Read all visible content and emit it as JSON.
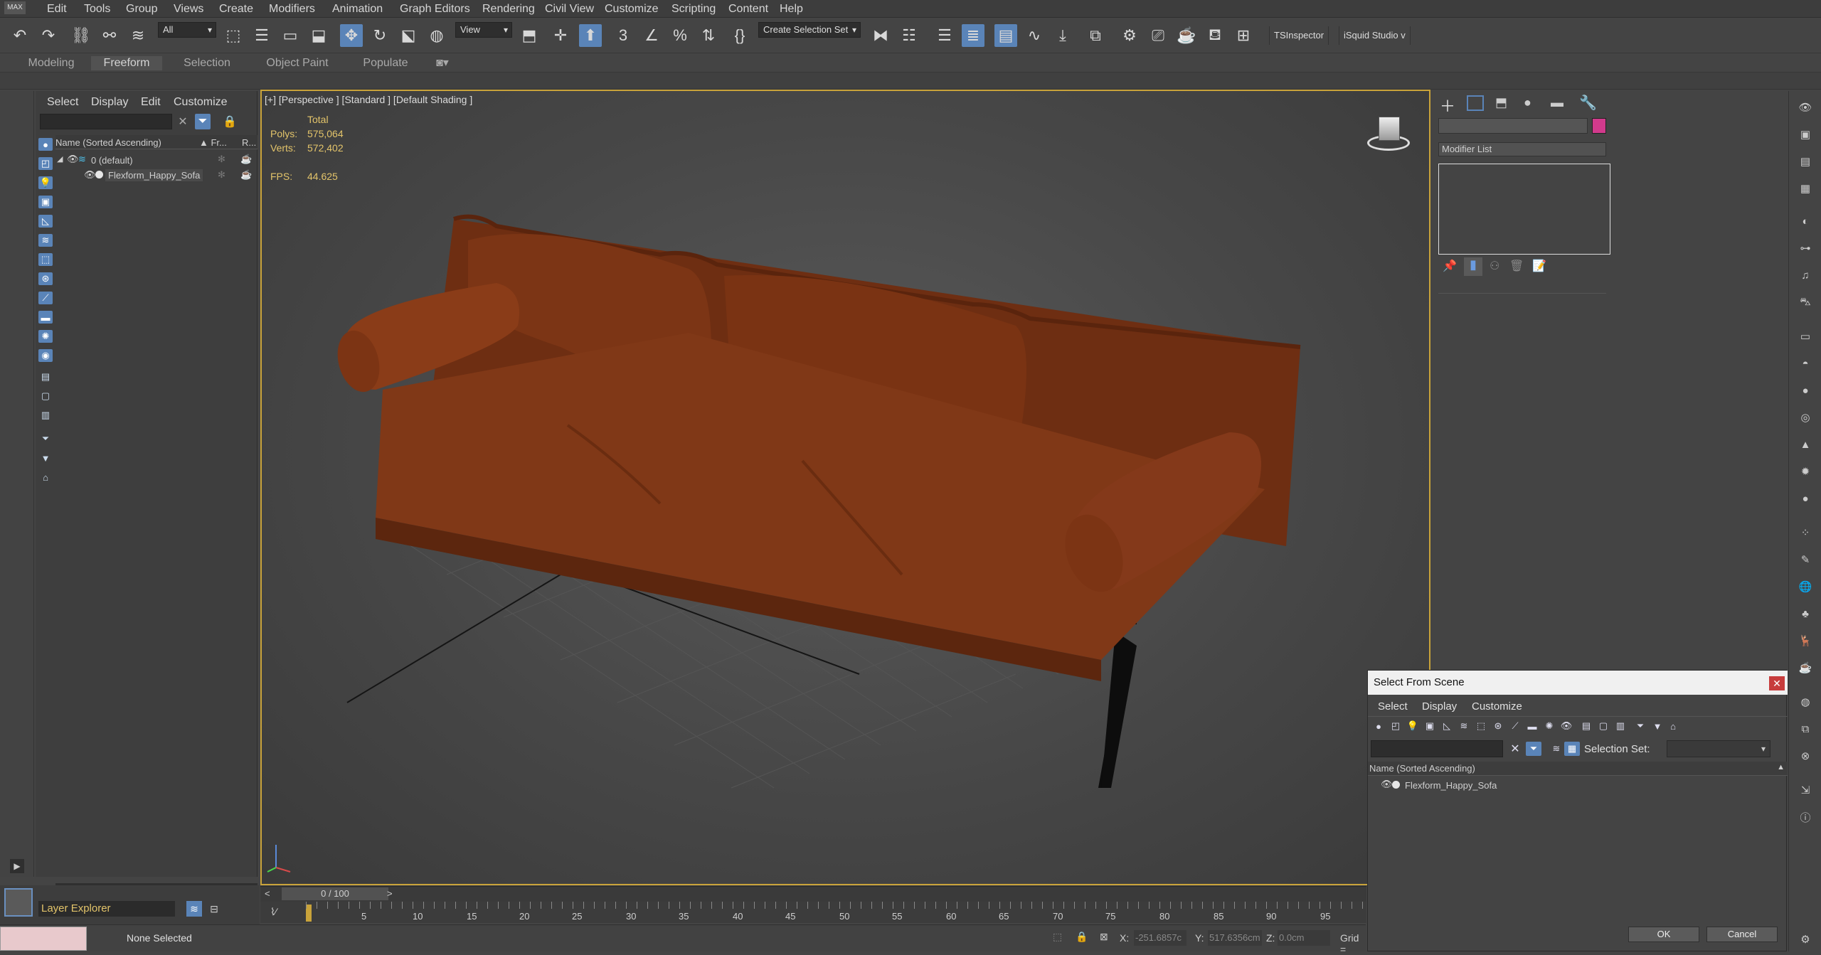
{
  "menubar": {
    "logo": "MAX",
    "items": [
      "Edit",
      "Tools",
      "Group",
      "Views",
      "Create",
      "Modifiers",
      "Animation",
      "Graph Editors",
      "Rendering",
      "Civil View",
      "Customize",
      "Scripting",
      "Content",
      "Help"
    ]
  },
  "toolbar": {
    "selection_filter": "All",
    "ref_coord": "View",
    "selection_set": "Create Selection Set",
    "plugin1": "TSInspector",
    "plugin2": "iSquid Studio v"
  },
  "ribbon": {
    "tabs": [
      "Modeling",
      "Freeform",
      "Selection",
      "Object Paint",
      "Populate"
    ],
    "active": "Freeform"
  },
  "explorer": {
    "menu": [
      "Select",
      "Display",
      "Edit",
      "Customize"
    ],
    "col_name": "Name (Sorted Ascending)",
    "col_fr": "▲ Fr...",
    "col_r": "R...",
    "rows": [
      {
        "label": "0 (default)"
      },
      {
        "label": "Flexform_Happy_Sofa"
      }
    ],
    "footer_label": "Layer Explorer"
  },
  "viewport": {
    "label": "[+] [Perspective ] [Standard ] [Default Shading ]",
    "stats_total": "Total",
    "polys_label": "Polys:",
    "polys_value": "575,064",
    "verts_label": "Verts:",
    "verts_value": "572,402",
    "fps_label": "FPS:",
    "fps_value": "44.625"
  },
  "cmdpanel": {
    "modifier_list": "Modifier List",
    "object_color": "#d23a8c"
  },
  "select_from_scene": {
    "title": "Select From Scene",
    "menu": [
      "Select",
      "Display",
      "Customize"
    ],
    "selection_set_label": "Selection Set:",
    "col_name": "Name (Sorted Ascending)",
    "rows": [
      "Flexform_Happy_Sofa"
    ],
    "ok": "OK",
    "cancel": "Cancel"
  },
  "timeline": {
    "frame": "0 / 100",
    "ticks": [
      "5",
      "10",
      "15",
      "20",
      "25",
      "30",
      "35",
      "40",
      "45",
      "50",
      "55",
      "60",
      "65",
      "70",
      "75",
      "80",
      "85",
      "90",
      "95"
    ]
  },
  "status": {
    "selection": "None Selected",
    "x_label": "X:",
    "x_value": "-251.6857c",
    "y_label": "Y:",
    "y_value": "517.6356cm",
    "z_label": "Z:",
    "z_value": "0.0cm",
    "grid_label": "Grid ="
  },
  "colors": {
    "accent": "#5a84b8",
    "viewport_border": "#c9a33a",
    "stats_text": "#e3c46a",
    "sofa": "#7a3414",
    "close_button": "#c73c3c"
  }
}
